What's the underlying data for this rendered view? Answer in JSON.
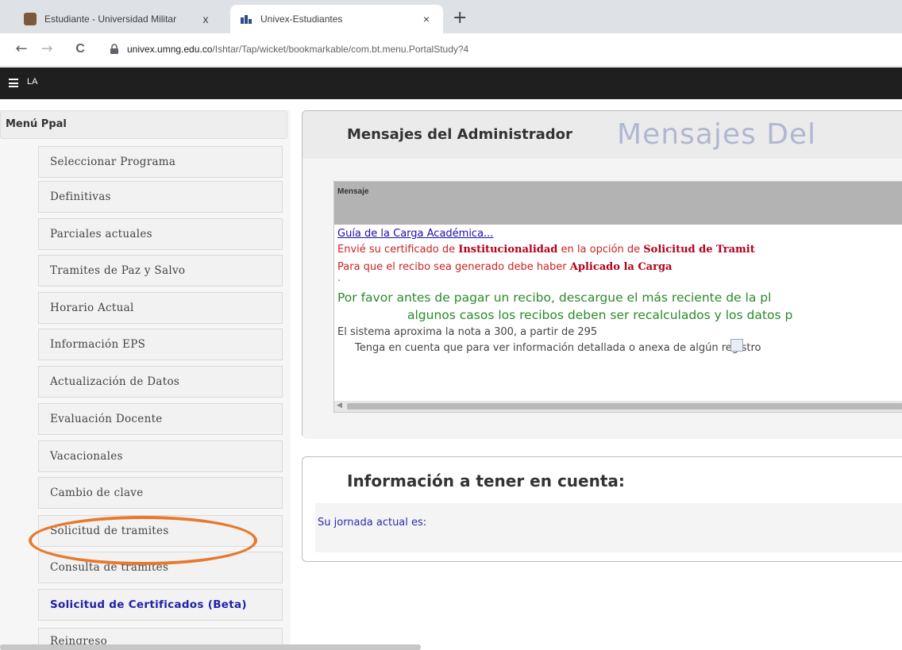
{
  "browser": {
    "tabs": [
      {
        "title": "Estudiante - Universidad Militar",
        "close": "x",
        "active": false
      },
      {
        "title": "Univex-Estudiantes",
        "close": "×",
        "active": true
      }
    ],
    "new_tab": "+",
    "nav": {
      "back": "←",
      "forward": "→",
      "reload": "C"
    },
    "url_host": "univex.umng.edu.co",
    "url_path": "/Ishtar/Tap/wicket/bookmarkable/com.bt.menu.PortalStudy?4"
  },
  "appbar": {
    "label": "LA"
  },
  "sidebar": {
    "header": "Menú Ppal",
    "items": [
      {
        "label": "Seleccionar Programa"
      },
      {
        "label": "Definitivas"
      },
      {
        "label": "Parciales actuales"
      },
      {
        "label": "Tramites de Paz y Salvo"
      },
      {
        "label": "Horario Actual"
      },
      {
        "label": "Información EPS"
      },
      {
        "label": "Actualización de Datos"
      },
      {
        "label": "Evaluación Docente"
      },
      {
        "label": "Vacacionales"
      },
      {
        "label": "Cambio de clave"
      },
      {
        "label": "Solicitud de tramites"
      },
      {
        "label": "Consulta de tramites"
      },
      {
        "label": "Solicitud de Certificados (Beta)"
      },
      {
        "label": "Reingreso"
      }
    ],
    "annotation_color": "#e8792d"
  },
  "messages_panel": {
    "title": "Mensajes del Administrador",
    "watermark": "Mensajes Del",
    "column_header": "Mensaje",
    "lines": {
      "guide_link": "Guía de la Carga Académica...",
      "cert_prefix": "Envié su certificado de ",
      "cert_bold1": "Institucionalidad",
      "cert_mid": " en la opción de ",
      "cert_bold2": "Solicitud de Tramit",
      "receipt_prefix": "Para que el recibo sea generado debe haber ",
      "receipt_bold": "Aplicado la Carga",
      "dot": ".",
      "green1": "Por favor antes de pagar un recibo, descargue el más reciente de la pl",
      "green2": "algunos casos los recibos deben ser recalculados y los datos p",
      "grade": "El sistema aproxima la nota a 300, a partir de 295",
      "note": "Tenga en cuenta que para ver información detallada o anexa de algún registro"
    }
  },
  "info_panel": {
    "title": "Información a tener en cuenta:",
    "jornada": "Su jornada actual es:"
  }
}
